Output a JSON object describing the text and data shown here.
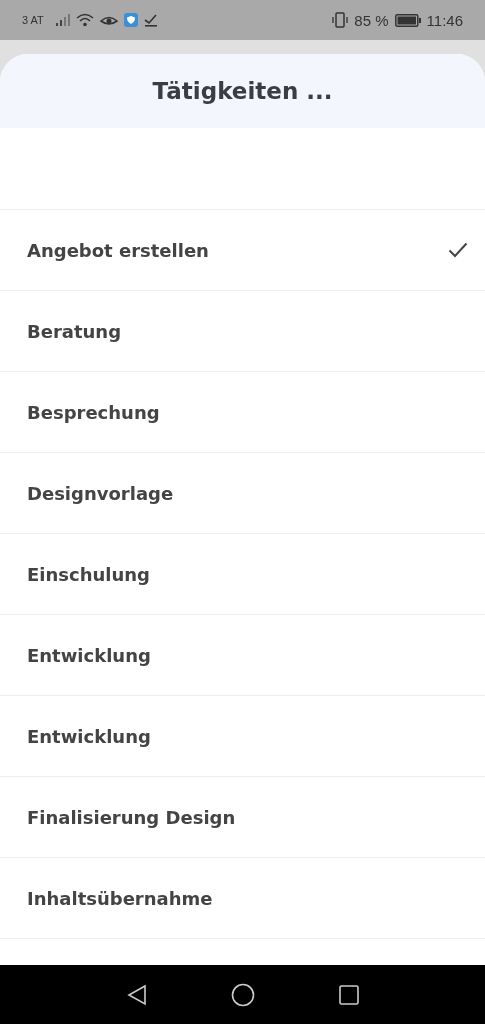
{
  "status_bar": {
    "carrier": "3 AT",
    "battery_percent": "85 %",
    "time": "11:46"
  },
  "sheet": {
    "title": "Tätigkeiten ..."
  },
  "items": [
    {
      "label": "Angebot erstellen",
      "selected": true
    },
    {
      "label": "Beratung",
      "selected": false
    },
    {
      "label": "Besprechung",
      "selected": false
    },
    {
      "label": "Designvorlage",
      "selected": false
    },
    {
      "label": "Einschulung",
      "selected": false
    },
    {
      "label": "Entwicklung",
      "selected": false
    },
    {
      "label": "Entwicklung",
      "selected": false
    },
    {
      "label": "Finalisierung Design",
      "selected": false
    },
    {
      "label": "Inhaltsübernahme",
      "selected": false
    }
  ]
}
